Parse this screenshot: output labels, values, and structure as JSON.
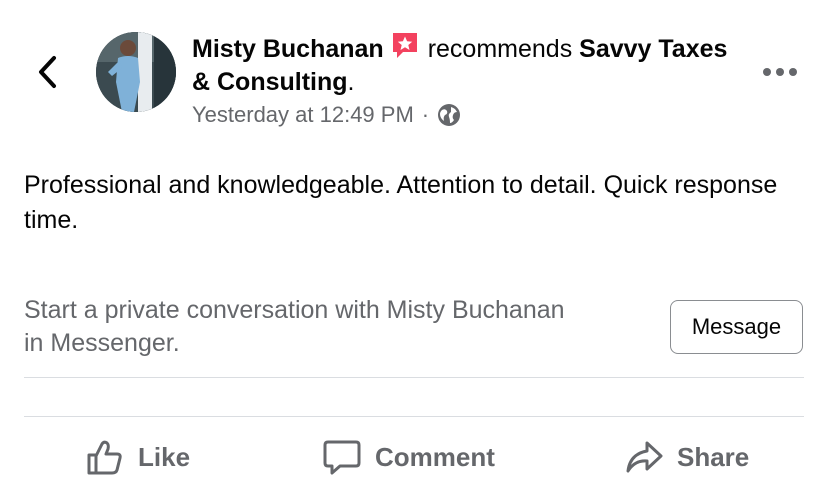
{
  "header": {
    "author": "Misty Buchanan",
    "verb": "recommends",
    "page_name": "Savvy Taxes & Consulting",
    "page_suffix": ".",
    "timestamp": "Yesterday at 12:49 PM",
    "separator": "·",
    "privacy_icon": "globe-icon",
    "badge_icon": "recommendation-star-icon",
    "badge_color": "#f3425f"
  },
  "review": {
    "text": "Professional and knowledgeable. Attention to detail. Quick response time."
  },
  "messenger": {
    "prompt": "Start a private conversation with Misty Buchanan in Messenger.",
    "button_label": "Message"
  },
  "actions": {
    "like_label": "Like",
    "comment_label": "Comment",
    "share_label": "Share",
    "icon_color": "#65676b"
  }
}
